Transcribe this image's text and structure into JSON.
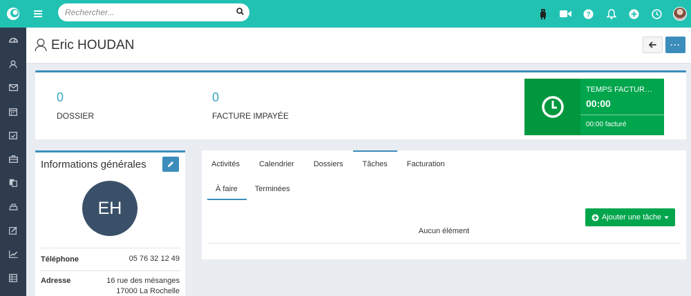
{
  "search": {
    "placeholder": "Rechercher..."
  },
  "header": {
    "title": "Eric HOUDAN",
    "more_label": "···"
  },
  "stats": [
    {
      "value": "0",
      "label": "DOSSIER"
    },
    {
      "value": "0",
      "label": "FACTURE IMPAYÉE"
    }
  ],
  "time_card": {
    "title": "TEMPS FACTUR…",
    "value": "00:00",
    "billed": "00:00 facturé"
  },
  "info": {
    "title": "Informations générales",
    "initials": "EH",
    "phone_label": "Téléphone",
    "phone_value": "05 76 32 12 49",
    "address_label": "Adresse",
    "address_line1": "16 rue des mésanges",
    "address_line2": "17000 La Rochelle"
  },
  "tabs": [
    "Activités",
    "Calendrier",
    "Dossiers",
    "Tâches",
    "Facturation"
  ],
  "active_tab": "Tâches",
  "subtabs": [
    "À faire",
    "Terminées"
  ],
  "active_subtab": "À faire",
  "add_task_label": "Ajouter une tâche",
  "empty_label": "Aucun élément",
  "colors": {
    "teal": "#22c2b3",
    "sidebar": "#2f3c4e",
    "blue": "#3c8dbc",
    "green": "#00a54c",
    "dark_green": "#00973e"
  },
  "icons": {
    "top": [
      "logo-icon",
      "menu-icon",
      "search-icon",
      "robot-icon",
      "video-icon",
      "help-icon",
      "bell-icon",
      "plus-circle-icon",
      "clock-icon",
      "user-avatar"
    ],
    "sidebar": [
      "dashboard-icon",
      "contacts-icon",
      "mail-icon",
      "calendar-icon",
      "tasks-icon",
      "briefcase-icon",
      "documents-icon",
      "billing-icon",
      "edit-icon",
      "chart-icon",
      "table-icon"
    ]
  }
}
